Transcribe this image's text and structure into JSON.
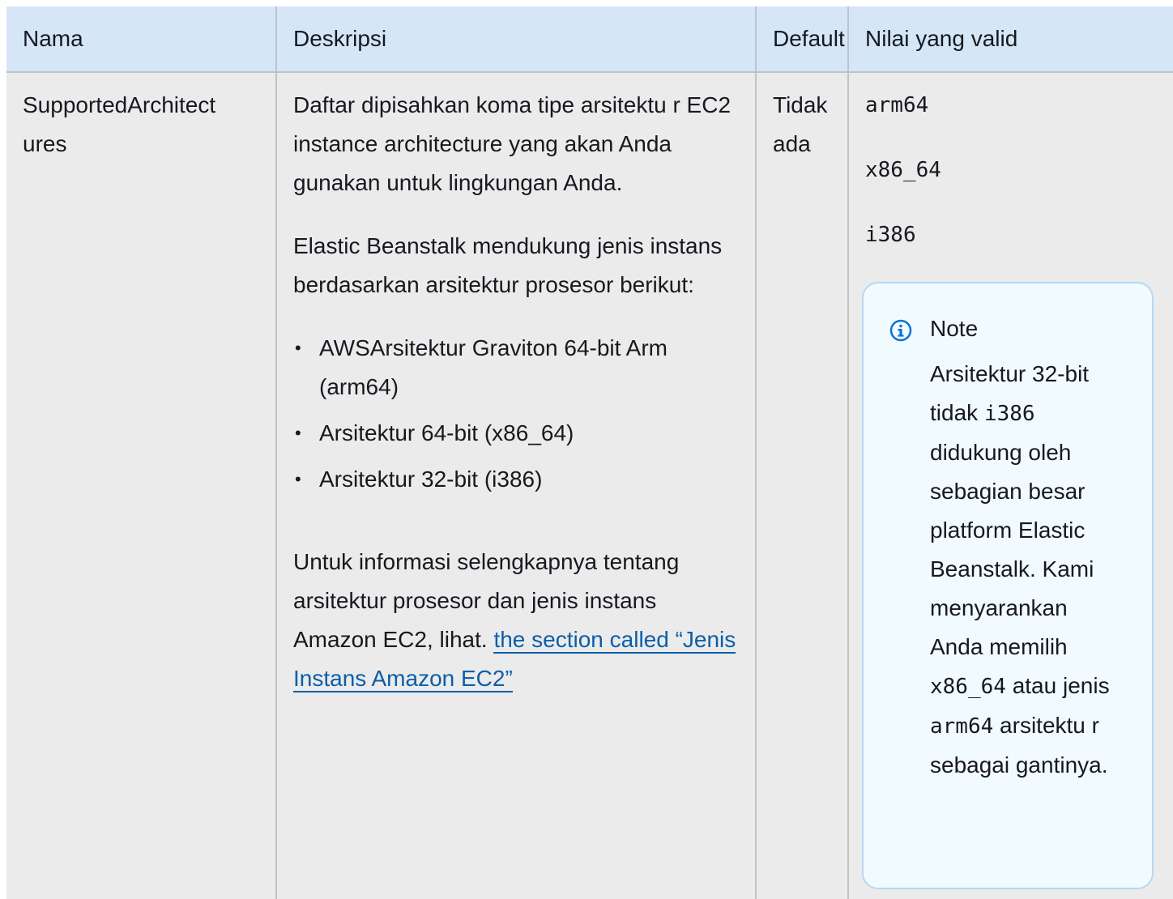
{
  "table": {
    "headers": {
      "name": "Nama",
      "description": "Deskripsi",
      "default": "Default",
      "valid_values": "Nilai yang valid"
    },
    "row": {
      "name_line1": "SupportedArchitect",
      "name_line2": "ures",
      "description": {
        "para1": "Daftar dipisahkan koma tipe arsitektu r EC2 instance architecture yang akan Anda gunakan untuk lingkungan Anda.",
        "para2": "Elastic Beanstalk mendukung jenis instans berdasarkan arsitektur prosesor berikut:",
        "list": [
          "AWSArsitektur Graviton 64-bit Arm (arm64)",
          "Arsitektur 64-bit (x86_64)",
          "Arsitektur 32-bit (i386)"
        ],
        "para3": "Untuk informasi selengkapnya tentang arsitektur prosesor dan jenis instans Amazon EC2, lihat.",
        "link": "the section called “Jenis Instans Amazon EC2”"
      },
      "default_line1": "Tidak",
      "default_line2": "ada",
      "valid_values": [
        "arm64",
        "x86_64",
        "i386"
      ],
      "note": {
        "title": "Note",
        "text1": "Arsitektur 32-bit tidak ",
        "code1": "i386",
        "text2": " didukung oleh sebagian besar platform Elastic Beanstalk. Kami menyarankan Anda memilih ",
        "code2": "x86_64",
        "text3": " atau jenis ",
        "code3": "arm64",
        "text4": " arsitektu r sebagai gantinya."
      }
    }
  },
  "colors": {
    "header_bg": "#d5e6f7",
    "body_bg": "#ebebeb",
    "link": "#0b5ea8",
    "note_bg": "#f1faff",
    "note_border": "#b3d9f5",
    "icon": "#0972d3"
  }
}
